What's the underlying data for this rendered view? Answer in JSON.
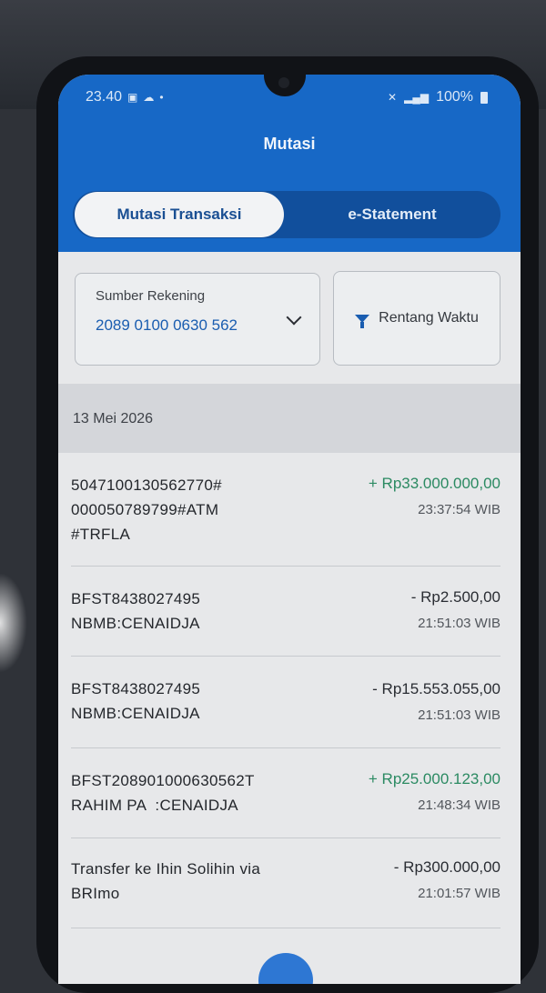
{
  "status_bar": {
    "time": "23.40",
    "battery": "100%"
  },
  "header": {
    "title": "Mutasi",
    "tabs": [
      {
        "label": "Mutasi Transaksi",
        "active": true
      },
      {
        "label": "e-Statement",
        "active": false
      }
    ]
  },
  "account": {
    "label": "Sumber Rekening",
    "number": "2089 0100 0630 562"
  },
  "filter": {
    "label": "Rentang Waktu",
    "icon": "filter-icon"
  },
  "date_header": "13 Mei 2026",
  "transactions": [
    {
      "lines": [
        "5047100130562770#",
        "000050789799#ATM",
        "#TRFLA"
      ],
      "amount": "+ Rp33.000.000,00",
      "time": "23:37:54 WIB",
      "type": "credit"
    },
    {
      "lines": [
        "BFST8438027495",
        "NBMB:CENAIDJA"
      ],
      "amount": "- Rp2.500,00",
      "time": "21:51:03 WIB",
      "type": "debit"
    },
    {
      "lines": [
        "BFST8438027495",
        "NBMB:CENAIDJA"
      ],
      "amount": "- Rp15.553.055,00",
      "time": "21:51:03 WIB",
      "type": "debit"
    },
    {
      "lines": [
        "BFST208901000630562T",
        "RAHIM PA  :CENAIDJA"
      ],
      "amount": "+ Rp25.000.123,00",
      "time": "21:48:34 WIB",
      "type": "credit"
    },
    {
      "lines": [
        "Transfer ke Ihin Solihin via",
        "BRImo"
      ],
      "amount": "- Rp300.000,00",
      "time": "21:01:57 WIB",
      "type": "debit"
    }
  ],
  "colors": {
    "primary": "#1768c6",
    "credit": "#2b8a62",
    "debit": "#2a2d33"
  }
}
